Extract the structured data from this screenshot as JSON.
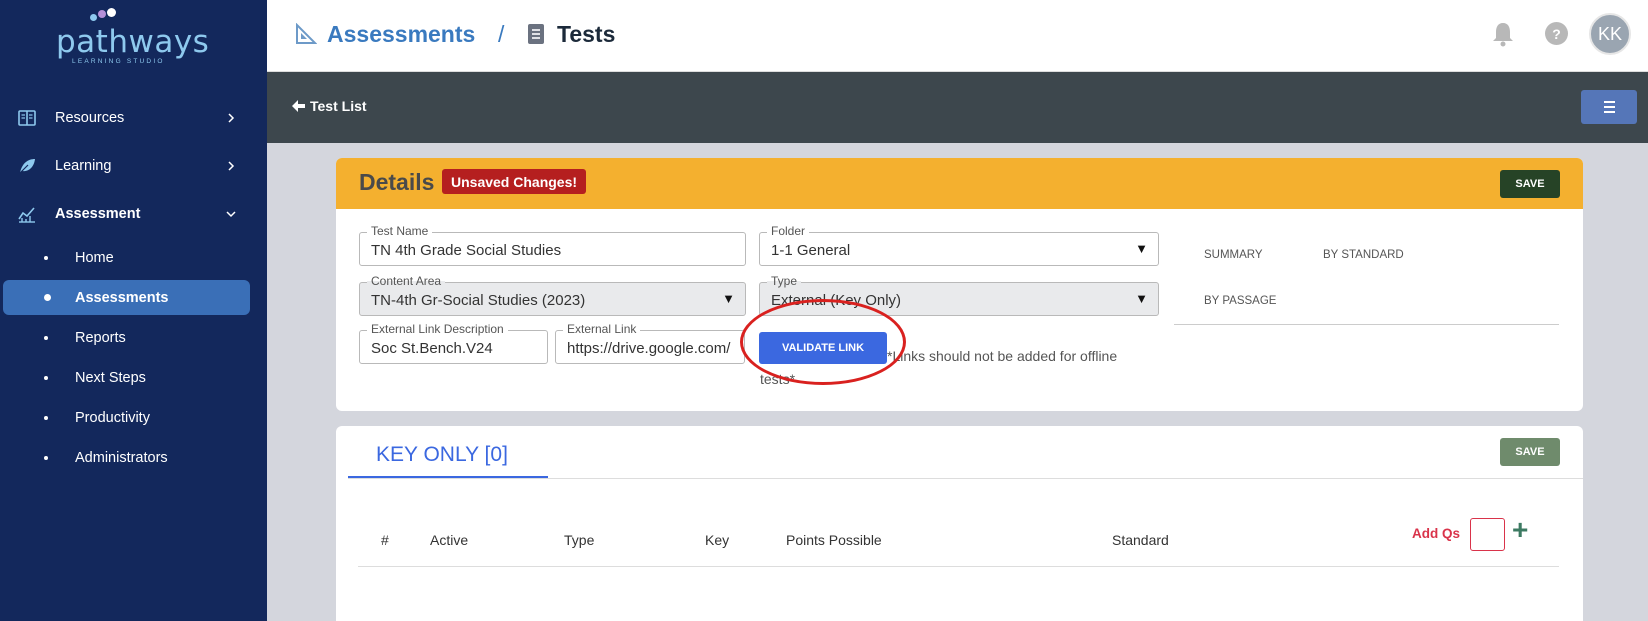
{
  "brand": {
    "name": "pathways",
    "tagline": "LEARNING STUDIO"
  },
  "sidebar": {
    "items": [
      {
        "label": "Resources",
        "icon": "book-icon"
      },
      {
        "label": "Learning",
        "icon": "leaf-icon"
      },
      {
        "label": "Assessment",
        "icon": "chart-icon"
      }
    ],
    "sub_items": [
      {
        "label": "Home"
      },
      {
        "label": "Assessments"
      },
      {
        "label": "Reports"
      },
      {
        "label": "Next Steps"
      },
      {
        "label": "Productivity"
      },
      {
        "label": "Administrators"
      }
    ]
  },
  "header": {
    "crumb_1": "Assessments",
    "separator": "/",
    "crumb_2": "Tests",
    "help_label": "?",
    "avatar_initials": "KK"
  },
  "subheader": {
    "back_label": "Test List"
  },
  "details": {
    "title": "Details",
    "unsaved_label": "Unsaved Changes!",
    "save_label": "SAVE",
    "test_name": {
      "label": "Test Name",
      "value": "TN 4th Grade Social Studies"
    },
    "folder": {
      "label": "Folder",
      "value": "1-1 General"
    },
    "content_area": {
      "label": "Content Area",
      "value": "TN-4th Gr-Social Studies (2023)"
    },
    "type": {
      "label": "Type",
      "value": "External (Key Only)"
    },
    "ext_desc": {
      "label": "External Link Description",
      "value": "Soc St.Bench.V24"
    },
    "ext_link": {
      "label": "External Link",
      "value": "https://drive.google.com/"
    },
    "validate_label": "VALIDATE LINK",
    "note": "*Links should not be added for offline tests*",
    "tabs": [
      "SUMMARY",
      "BY STANDARD",
      "BY PASSAGE"
    ]
  },
  "key_only": {
    "tab_label": "KEY ONLY [0]",
    "save_label": "SAVE",
    "columns": [
      "#",
      "Active",
      "Type",
      "Key",
      "Points Possible",
      "Standard"
    ],
    "add_qs_label": "Add Qs",
    "add_label": "+"
  },
  "colors": {
    "sidebar": "#13285c",
    "accent": "#3b68e0",
    "warning": "#f4b02f",
    "danger": "#b51f1f"
  }
}
